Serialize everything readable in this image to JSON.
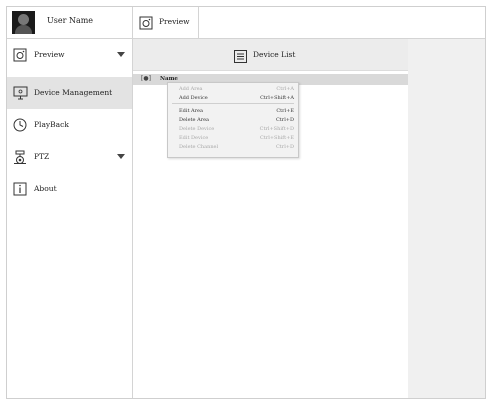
{
  "header": {
    "user_name": "User Name",
    "tab_label": "Preview"
  },
  "sidebar": {
    "items": [
      {
        "label": "Preview",
        "icon": "preview-icon",
        "has_caret": true,
        "selected": false
      },
      {
        "label": "Device Management",
        "icon": "monitor-icon",
        "has_caret": false,
        "selected": true
      },
      {
        "label": "PlayBack",
        "icon": "clock-icon",
        "has_caret": false,
        "selected": false
      },
      {
        "label": "PTZ",
        "icon": "ptz-camera-icon",
        "has_caret": true,
        "selected": false
      },
      {
        "label": "About",
        "icon": "info-icon",
        "has_caret": false,
        "selected": false
      }
    ]
  },
  "device_list": {
    "title": "Device List",
    "tree_root_label": "Name"
  },
  "context_menu": {
    "items": [
      {
        "label": "Add Area",
        "shortcut": "Ctrl+A",
        "enabled": false
      },
      {
        "label": "Add Device",
        "shortcut": "Ctrl+Shift+A",
        "enabled": true
      },
      {
        "label": "Edit Area",
        "shortcut": "Ctrl+E",
        "enabled": true
      },
      {
        "label": "Delete Area",
        "shortcut": "Ctrl+D",
        "enabled": true
      },
      {
        "label": "Delete Device",
        "shortcut": "Ctrl+Shift+D",
        "enabled": false
      },
      {
        "label": "Edit Device",
        "shortcut": "Ctrl+Shift+E",
        "enabled": false
      },
      {
        "label": "Delete Channel",
        "shortcut": "Ctrl+D",
        "enabled": false
      }
    ]
  },
  "colors": {
    "selected_bg": "#e3e3e3",
    "header_bg": "#ececec",
    "right_panel_bg": "#f0f0f0",
    "disabled_text": "#a8a8a8"
  }
}
